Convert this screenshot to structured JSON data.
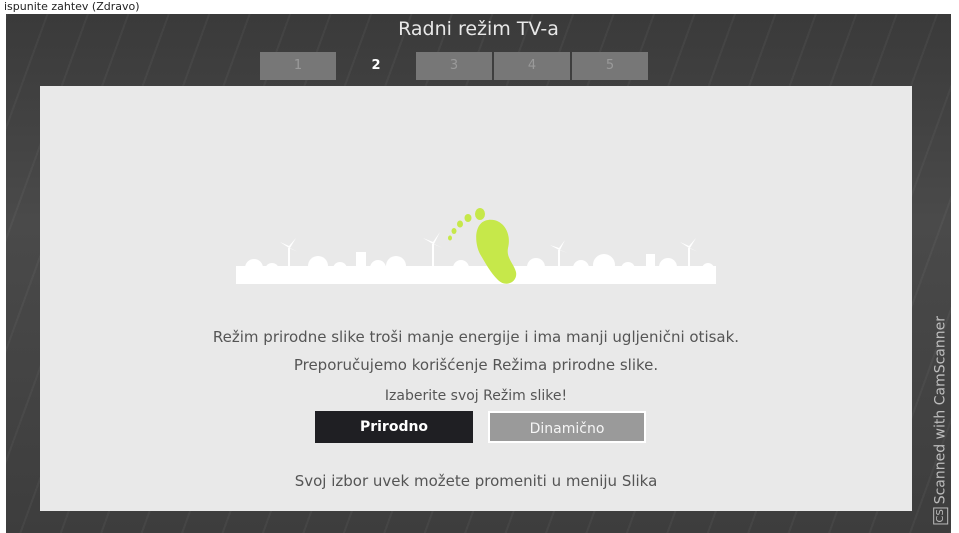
{
  "photo_header": "ispunite zahtev (Zdravo)",
  "screen": {
    "title": "Radni režim TV-a",
    "steps": [
      "1",
      "2",
      "3",
      "4",
      "5"
    ],
    "active_step": "2"
  },
  "dialog": {
    "message_line1": "Režim prirodne slike troši manje energije i ima manji ugljenični otisak.",
    "message_line2": "Preporučujemo korišćenje Režima prirodne slike.",
    "prompt": "Izaberite svoj Režim slike!",
    "option_natural": "Prirodno",
    "option_dynamic": "Dinamično",
    "footer_note": "Svoj izbor uvek možete promeniti u meniju Slika"
  },
  "watermark": {
    "logo": "CS",
    "text": "Scanned with CamScanner"
  },
  "colors": {
    "footprint": "#c6e84a",
    "selected_button": "#1f1f23",
    "panel": "#e9e9e9"
  }
}
